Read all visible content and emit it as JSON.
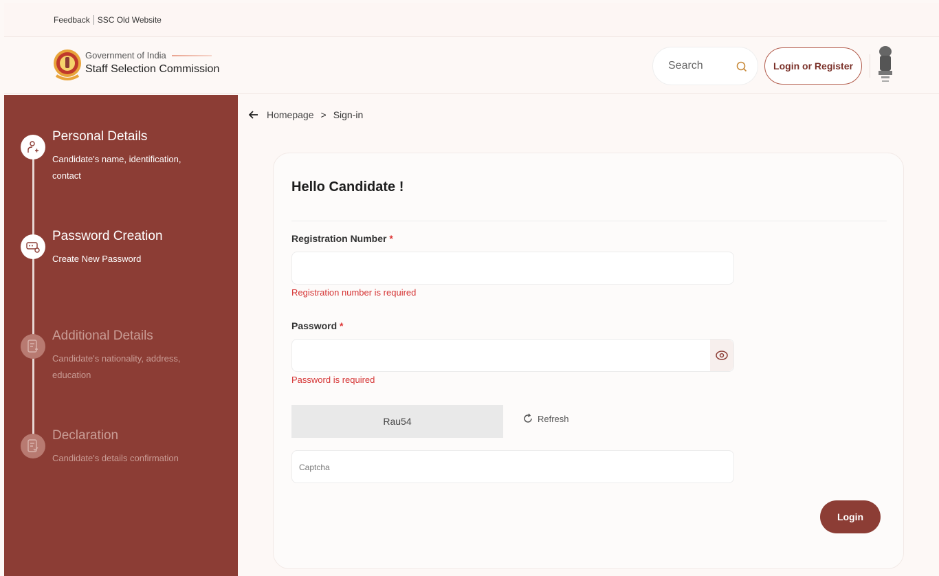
{
  "topbar": {
    "feedback": "Feedback",
    "old_website": "SSC Old Website"
  },
  "header": {
    "gov": "Government of India",
    "org": "Staff Selection Commission",
    "search_placeholder": "Search",
    "login_register": "Login or Register"
  },
  "sidebar": {
    "steps": [
      {
        "title": "Personal Details",
        "desc": "Candidate's name, identification, contact",
        "active": true
      },
      {
        "title": "Password Creation",
        "desc": "Create New Password",
        "active": true
      },
      {
        "title": "Additional Details",
        "desc": "Candidate's nationality, address, education",
        "active": false
      },
      {
        "title": "Declaration",
        "desc": "Candidate's details confirmation",
        "active": false
      }
    ]
  },
  "breadcrumb": {
    "home": "Homepage",
    "sep": ">",
    "current": "Sign-in"
  },
  "form": {
    "greeting": "Hello Candidate !",
    "reg_label": "Registration Number",
    "reg_error": "Registration number is required",
    "password_label": "Password",
    "password_error": "Password is required",
    "required_mark": "*",
    "captcha_text": "Rau54",
    "refresh": "Refresh",
    "captcha_placeholder": "Captcha",
    "login": "Login"
  },
  "colors": {
    "brand": "#8c3d35",
    "error": "#d53434",
    "accent_border": "#b25c4c"
  }
}
